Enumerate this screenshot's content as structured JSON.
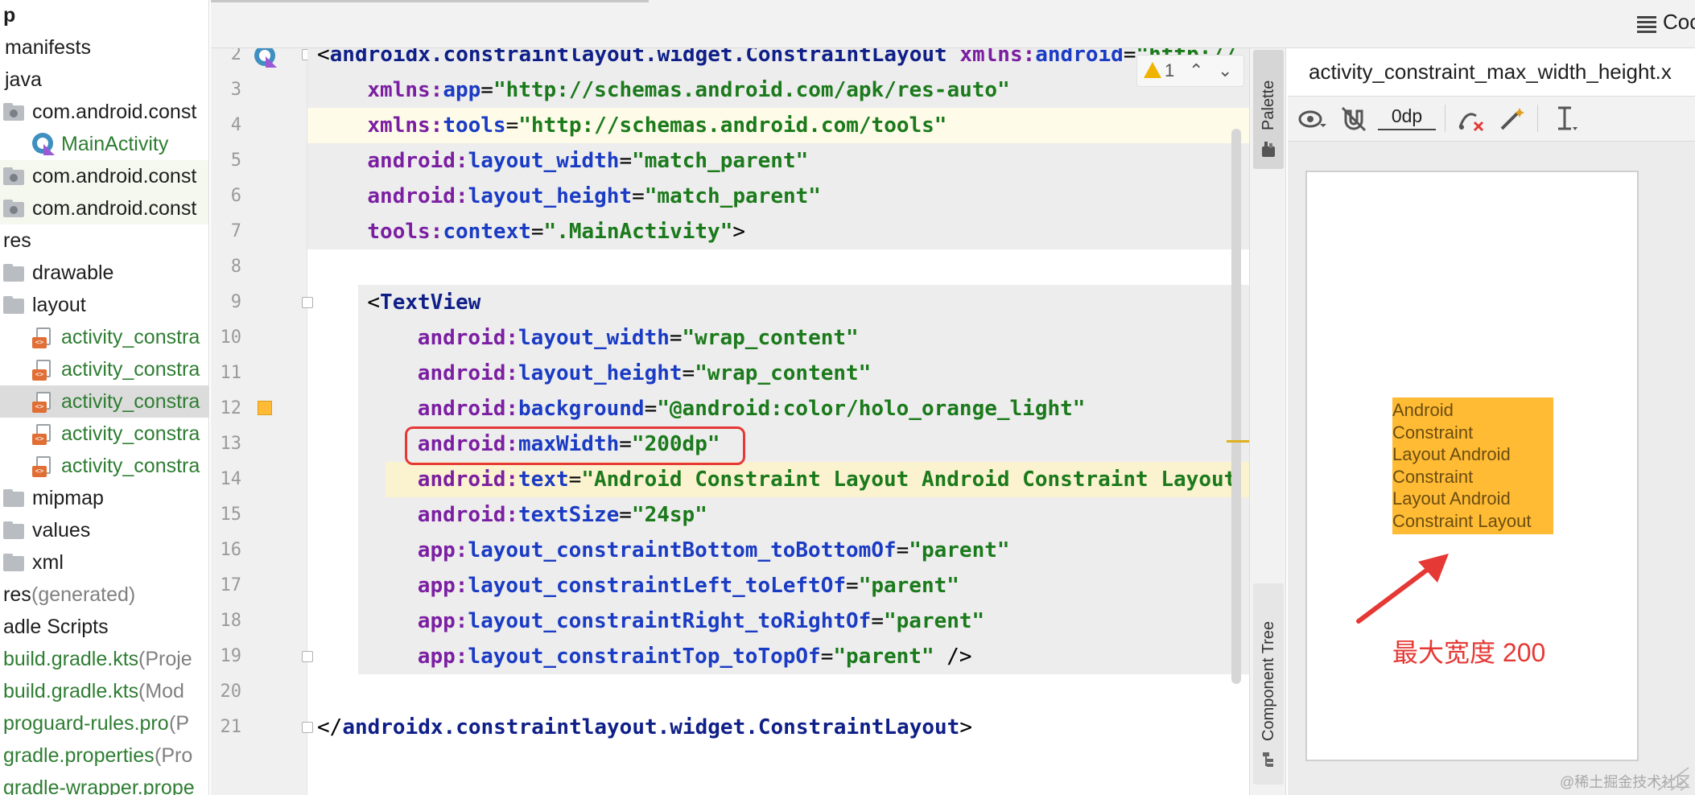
{
  "project_tree": {
    "items": [
      {
        "label": "p",
        "type": "text",
        "indent": 0,
        "style": "bold"
      },
      {
        "label": "manifests",
        "type": "text",
        "indent": 1
      },
      {
        "label": "java",
        "type": "text",
        "indent": 1
      },
      {
        "label": "com.android.const",
        "type": "package",
        "indent": 1
      },
      {
        "label": "MainActivity",
        "type": "kotlin",
        "indent": 2,
        "style": "green"
      },
      {
        "label": "com.android.const",
        "type": "package",
        "indent": 1,
        "tint": true
      },
      {
        "label": "com.android.const",
        "type": "package",
        "indent": 1,
        "tint": true
      },
      {
        "label": "res",
        "type": "text",
        "indent": 0
      },
      {
        "label": "drawable",
        "type": "folder",
        "indent": 1
      },
      {
        "label": "layout",
        "type": "folder",
        "indent": 1
      },
      {
        "label": "activity_constra",
        "type": "xml",
        "indent": 2,
        "style": "green"
      },
      {
        "label": "activity_constra",
        "type": "xml",
        "indent": 2,
        "style": "green"
      },
      {
        "label": "activity_constra",
        "type": "xml",
        "indent": 2,
        "style": "green",
        "selected": true
      },
      {
        "label": "activity_constra",
        "type": "xml",
        "indent": 2,
        "style": "green"
      },
      {
        "label": "activity_constra",
        "type": "xml",
        "indent": 2,
        "style": "green"
      },
      {
        "label": "mipmap",
        "type": "folder",
        "indent": 1
      },
      {
        "label": "values",
        "type": "folder",
        "indent": 1
      },
      {
        "label": "xml",
        "type": "folder",
        "indent": 1
      },
      {
        "label": "res",
        "suffix": " (generated)",
        "type": "text",
        "indent": 0
      },
      {
        "label": "adle Scripts",
        "type": "text",
        "indent": 0
      },
      {
        "label": "build.gradle.kts",
        "suffix": " (Proje",
        "type": "text",
        "indent": 0,
        "style": "green"
      },
      {
        "label": "build.gradle.kts",
        "suffix": " (Mod",
        "type": "text",
        "indent": 0,
        "style": "green"
      },
      {
        "label": "proguard-rules.pro",
        "suffix": " (P",
        "type": "text",
        "indent": 0,
        "style": "green"
      },
      {
        "label": "gradle.properties",
        "suffix": " (Pro",
        "type": "text",
        "indent": 0,
        "style": "green"
      },
      {
        "label": "gradle-wrapper.prope",
        "type": "text",
        "indent": 0,
        "style": "green"
      }
    ]
  },
  "topbar": {
    "code_label": "Coc"
  },
  "editor": {
    "inspection": {
      "warning_count": "1",
      "up": "⌃",
      "down": "⌄"
    },
    "lines": [
      {
        "n": "2",
        "tokens": [
          [
            "punc",
            "<"
          ],
          [
            "tag",
            "androidx.constraintlayout.widget.ConstraintLayout"
          ],
          [
            "punc",
            " "
          ],
          [
            "ns",
            "xmlns:"
          ],
          [
            "attr",
            "android"
          ],
          [
            "eq",
            "="
          ],
          [
            "val",
            "\"http://"
          ]
        ]
      },
      {
        "n": "3",
        "indent": 2,
        "tokens": [
          [
            "ns",
            "xmlns:"
          ],
          [
            "attr",
            "app"
          ],
          [
            "eq",
            "="
          ],
          [
            "val",
            "\"http://schemas.android.com/apk/res-auto\""
          ]
        ]
      },
      {
        "n": "4",
        "indent": 2,
        "tokens": [
          [
            "ns",
            "xmlns:"
          ],
          [
            "attr",
            "tools"
          ],
          [
            "eq",
            "="
          ],
          [
            "val",
            "\"http://schemas.android.com/tools\""
          ]
        ]
      },
      {
        "n": "5",
        "indent": 2,
        "tokens": [
          [
            "ns",
            "android:"
          ],
          [
            "attr",
            "layout_width"
          ],
          [
            "eq",
            "="
          ],
          [
            "val",
            "\"match_parent\""
          ]
        ]
      },
      {
        "n": "6",
        "indent": 2,
        "tokens": [
          [
            "ns",
            "android:"
          ],
          [
            "attr",
            "layout_height"
          ],
          [
            "eq",
            "="
          ],
          [
            "val",
            "\"match_parent\""
          ]
        ]
      },
      {
        "n": "7",
        "indent": 2,
        "tokens": [
          [
            "ns",
            "tools:"
          ],
          [
            "attr",
            "context"
          ],
          [
            "eq",
            "="
          ],
          [
            "val",
            "\".MainActivity\""
          ],
          [
            "punc",
            ">"
          ]
        ]
      },
      {
        "n": "8",
        "indent": 0,
        "tokens": []
      },
      {
        "n": "9",
        "indent": 2,
        "tokens": [
          [
            "punc",
            "<"
          ],
          [
            "tag",
            "TextView"
          ]
        ]
      },
      {
        "n": "10",
        "indent": 4,
        "tokens": [
          [
            "ns",
            "android:"
          ],
          [
            "attr",
            "layout_width"
          ],
          [
            "eq",
            "="
          ],
          [
            "val",
            "\"wrap_content\""
          ]
        ]
      },
      {
        "n": "11",
        "indent": 4,
        "tokens": [
          [
            "ns",
            "android:"
          ],
          [
            "attr",
            "layout_height"
          ],
          [
            "eq",
            "="
          ],
          [
            "val",
            "\"wrap_content\""
          ]
        ]
      },
      {
        "n": "12",
        "indent": 4,
        "tokens": [
          [
            "ns",
            "android:"
          ],
          [
            "attr",
            "background"
          ],
          [
            "eq",
            "="
          ],
          [
            "val",
            "\"@android:color/holo_orange_light\""
          ]
        ]
      },
      {
        "n": "13",
        "indent": 4,
        "tokens": [
          [
            "ns",
            "android:"
          ],
          [
            "attr",
            "maxWidth"
          ],
          [
            "eq",
            "="
          ],
          [
            "val",
            "\"200dp\""
          ]
        ]
      },
      {
        "n": "14",
        "indent": 4,
        "tokens": [
          [
            "ns",
            "android:"
          ],
          [
            "attr",
            "text"
          ],
          [
            "eq",
            "="
          ],
          [
            "val",
            "\"Android Constraint Layout Android Constraint Layout"
          ]
        ]
      },
      {
        "n": "15",
        "indent": 4,
        "tokens": [
          [
            "ns",
            "android:"
          ],
          [
            "attr",
            "textSize"
          ],
          [
            "eq",
            "="
          ],
          [
            "val",
            "\"24sp\""
          ]
        ]
      },
      {
        "n": "16",
        "indent": 4,
        "tokens": [
          [
            "ns",
            "app:"
          ],
          [
            "attr",
            "layout_constraintBottom_toBottomOf"
          ],
          [
            "eq",
            "="
          ],
          [
            "val",
            "\"parent\""
          ]
        ]
      },
      {
        "n": "17",
        "indent": 4,
        "tokens": [
          [
            "ns",
            "app:"
          ],
          [
            "attr",
            "layout_constraintLeft_toLeftOf"
          ],
          [
            "eq",
            "="
          ],
          [
            "val",
            "\"parent\""
          ]
        ]
      },
      {
        "n": "18",
        "indent": 4,
        "tokens": [
          [
            "ns",
            "app:"
          ],
          [
            "attr",
            "layout_constraintRight_toRightOf"
          ],
          [
            "eq",
            "="
          ],
          [
            "val",
            "\"parent\""
          ]
        ]
      },
      {
        "n": "19",
        "indent": 4,
        "tokens": [
          [
            "ns",
            "app:"
          ],
          [
            "attr",
            "layout_constraintTop_toTopOf"
          ],
          [
            "eq",
            "="
          ],
          [
            "val",
            "\"parent\""
          ],
          [
            "punc",
            " />"
          ]
        ]
      },
      {
        "n": "20",
        "indent": 0,
        "tokens": []
      },
      {
        "n": "21",
        "indent": 0,
        "tokens": [
          [
            "punc",
            "</"
          ],
          [
            "tag",
            "androidx.constraintlayout.widget.ConstraintLayout"
          ],
          [
            "punc",
            ">"
          ]
        ]
      }
    ]
  },
  "side_tabs": {
    "palette": "Palette",
    "component_tree": "Component Tree"
  },
  "design": {
    "title": "activity_constraint_max_width_height.x",
    "margin_value": "0dp",
    "preview_text": "Android Constraint Layout Android Constraint Layout Android Constraint Layout",
    "preview_lines": [
      "Android",
      "Constraint",
      "Layout Android",
      "Constraint",
      "Layout Android",
      "Constraint Layout"
    ],
    "preview_bg": "#ffbb33"
  },
  "annotation": {
    "text": "最大宽度 200",
    "color": "#e53935"
  },
  "watermark": "@稀土掘金技术社区"
}
